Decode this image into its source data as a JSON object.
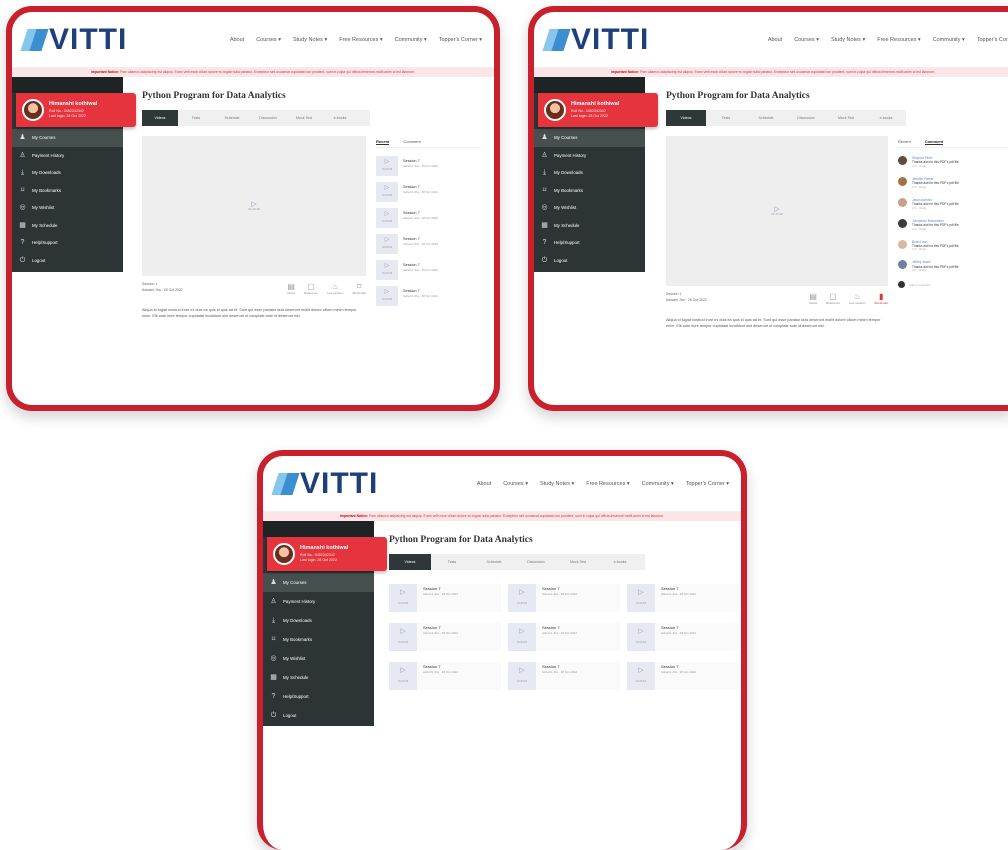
{
  "brand": {
    "logo_text": "VITTI"
  },
  "nav": [
    "About",
    "Courses ▾",
    "Study Notes ▾",
    "Free Resources ▾",
    "Community ▾",
    "Topper's Corner ▾"
  ],
  "notice": {
    "label": "Important Notice:",
    "text": "Pam ullamco adipisicing est aliquip. Eram velit esse cillum dolore eu fugiat nulla pariatur. Excepteur sint occaecat cupidatat non proident, sunt in culpa qui officia deserunt mollit anim id est laborum."
  },
  "profile": {
    "name": "Himanshi kothiwal",
    "roll": "Roll No.: 3452342342",
    "meta": "Last login: 28 Oct 2022"
  },
  "menu": [
    {
      "label": "My Courses",
      "icon": "courses-icon"
    },
    {
      "label": "Payment History",
      "icon": "payment-icon"
    },
    {
      "label": "My Downloads",
      "icon": "download-icon"
    },
    {
      "label": "My Bookmarks",
      "icon": "bookmark-icon"
    },
    {
      "label": "My Wishlist",
      "icon": "wishlist-icon"
    },
    {
      "label": "My Schedule",
      "icon": "schedule-icon"
    },
    {
      "label": "Help/Support",
      "icon": "help-icon"
    },
    {
      "label": "Logout",
      "icon": "logout-icon"
    }
  ],
  "course": {
    "title": "Python Program for Data Analytics"
  },
  "tabs": [
    "Videos",
    "Tests",
    "Schedule",
    "Discussion",
    "Mock Test",
    "e-books"
  ],
  "player": {
    "time": "01:23:18"
  },
  "video": {
    "title": "Session 1",
    "meta": "Ashwini Jha · 28 Oct 2022",
    "description": "Aliqua id fugiat nostrud irure ex duis ea quis id quis ad et. Sunt qui esse pariatur duis deserunt mollit dolore cillum minim tempor enim. Elit aute irure tempor cupidatat incididunt sint deserunt ut voluptate aute id deserunt nisi."
  },
  "actions": [
    "Notes",
    "Reference",
    "Live session",
    "Bookmark"
  ],
  "side_tabs": [
    "Recent",
    "Comment"
  ],
  "session": {
    "title": "Session 7",
    "time": "01:23:18",
    "meta": "Ashwini Jha · 28 Oct 2022"
  },
  "comments": [
    {
      "name": "Stephen Flintz",
      "text": "Thanks alot for this PDF's pdf file",
      "time": "2 hr · Reply"
    },
    {
      "name": "Jennifer Parker",
      "text": "Thanks alot for this PDF's pdf file",
      "time": "2 hr · Reply"
    },
    {
      "name": "Jason Antonio",
      "text": "Thanks alot for this PDF's pdf file",
      "time": "2 hr · Reply"
    },
    {
      "name": "Johnathon Richardson",
      "text": "Thanks alot for this PDF's pdf file",
      "time": "2 hr · Reply"
    },
    {
      "name": "Brian Lunn",
      "text": "Thanks alot for this PDF's pdf file",
      "time": "2 hr · Reply"
    },
    {
      "name": "Jeffrey Jewel",
      "text": "Thanks alot for this PDF's pdf file",
      "time": "2 hr · Reply"
    }
  ],
  "comment_placeholder": "Add a comment...",
  "colors": {
    "frame": "#c8202d",
    "sidebar": "#2d3436",
    "profile": "#e5343d",
    "logo": "#1d3f7a"
  }
}
